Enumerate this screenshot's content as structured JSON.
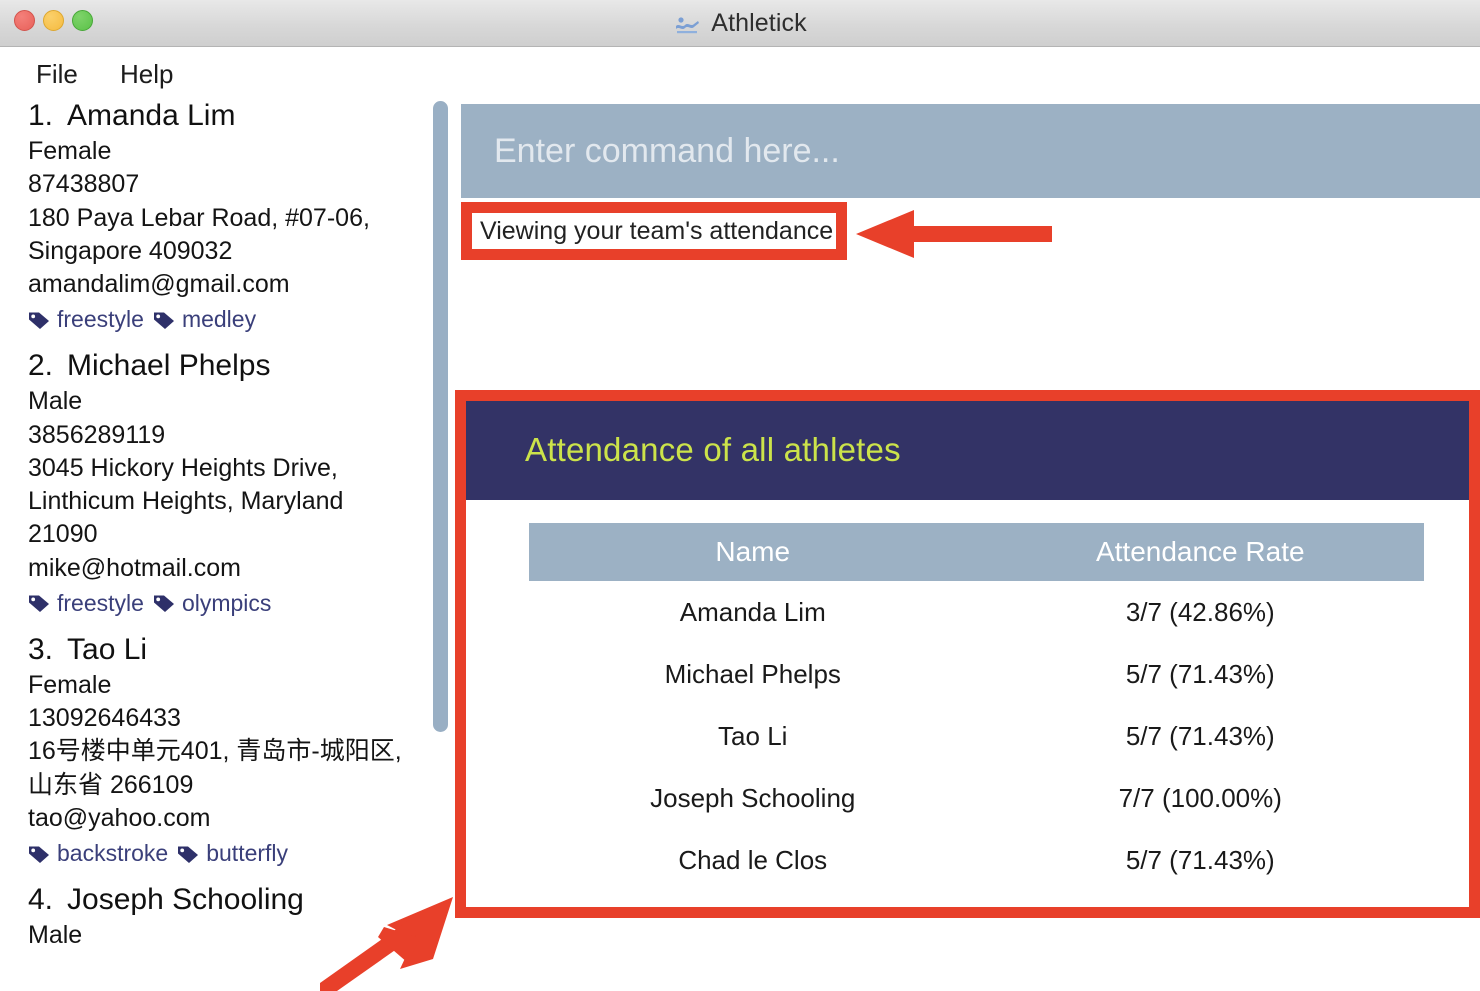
{
  "window": {
    "title": "Athletick",
    "logo_icon": "swimmer-logo-icon",
    "traffic_lights": [
      "close-button",
      "minimize-button",
      "zoom-button"
    ]
  },
  "menubar": {
    "items": [
      {
        "label": "File"
      },
      {
        "label": "Help"
      }
    ]
  },
  "colors": {
    "accent_navy": "#333366",
    "panel_title_green": "#cce34a",
    "steel_blue": "#9cb1c4",
    "annotation_red": "#e8402a",
    "tag_navy": "#3a3f7a"
  },
  "command": {
    "placeholder": "Enter command here...",
    "value": ""
  },
  "result": {
    "text": "Viewing your team's attendance"
  },
  "person_list": {
    "people": [
      {
        "index": "1.",
        "name": "Amanda Lim",
        "gender": "Female",
        "phone": "87438807",
        "address": "180 Paya Lebar Road, #07-06, Singapore 409032",
        "email": "amandalim@gmail.com",
        "tags": [
          "freestyle",
          "medley"
        ]
      },
      {
        "index": "2.",
        "name": "Michael Phelps",
        "gender": "Male",
        "phone": "3856289119",
        "address": "3045 Hickory Heights Drive, Linthicum Heights, Maryland 21090",
        "email": "mike@hotmail.com",
        "tags": [
          "freestyle",
          "olympics"
        ]
      },
      {
        "index": "3.",
        "name": "Tao Li",
        "gender": "Female",
        "phone": "13092646433",
        "address": "16号楼中单元401, 青岛市-城阳区, 山东省 266109",
        "email": "tao@yahoo.com",
        "tags": [
          "backstroke",
          "butterfly"
        ]
      },
      {
        "index": "4.",
        "name": "Joseph Schooling",
        "gender": "Male",
        "phone": "",
        "address": "",
        "email": "",
        "tags": []
      }
    ]
  },
  "attendance_panel": {
    "title": "Attendance of all athletes",
    "table": {
      "headers": [
        "Name",
        "Attendance Rate"
      ],
      "rows": [
        {
          "name": "Amanda Lim",
          "rate": "3/7 (42.86%)"
        },
        {
          "name": "Michael Phelps",
          "rate": "5/7 (71.43%)"
        },
        {
          "name": "Tao Li",
          "rate": "5/7 (71.43%)"
        },
        {
          "name": "Joseph Schooling",
          "rate": "7/7 (100.00%)"
        },
        {
          "name": "Chad le Clos",
          "rate": "5/7 (71.43%)"
        }
      ]
    }
  },
  "annotations": {
    "highlight_result_box": true,
    "highlight_attendance_panel": true,
    "arrow_to_result": "left-arrow",
    "arrow_to_panel": "diagonal-up-right-arrow"
  }
}
